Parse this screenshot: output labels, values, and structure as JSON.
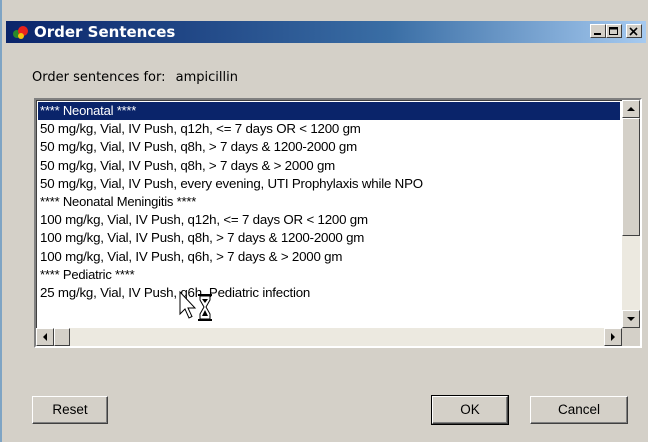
{
  "window": {
    "title": "Order Sentences",
    "icon": "cerner-app-icon",
    "controls": [
      "minimize-icon",
      "maximize-icon",
      "close-icon"
    ]
  },
  "prompt": {
    "label": "Order sentences for:",
    "drug": "ampicillin"
  },
  "list": {
    "selected_index": 0,
    "items": [
      {
        "text": "**** Neonatal ****",
        "kind": "header"
      },
      {
        "text": "50 mg/kg, Vial, IV Push, q12h, <= 7 days OR < 1200 gm",
        "kind": "sentence"
      },
      {
        "text": "50 mg/kg, Vial, IV Push, q8h, > 7 days & 1200-2000 gm",
        "kind": "sentence"
      },
      {
        "text": "50 mg/kg, Vial, IV Push, q8h, > 7 days & > 2000 gm",
        "kind": "sentence"
      },
      {
        "text": "50 mg/kg, Vial, IV Push, every evening, UTI Prophylaxis while NPO",
        "kind": "sentence"
      },
      {
        "text": "**** Neonatal Meningitis ****",
        "kind": "header"
      },
      {
        "text": "100 mg/kg, Vial, IV Push, q12h, <= 7 days OR < 1200 gm",
        "kind": "sentence"
      },
      {
        "text": "100 mg/kg, Vial, IV Push, q8h, > 7 days & 1200-2000 gm",
        "kind": "sentence"
      },
      {
        "text": "100 mg/kg, Vial, IV Push, q6h, > 7 days & > 2000 gm",
        "kind": "sentence"
      },
      {
        "text": "**** Pediatric ****",
        "kind": "header"
      },
      {
        "text": "25 mg/kg, Vial, IV Push, q6h, Pediatric infection",
        "kind": "sentence"
      },
      {
        "text": "",
        "kind": "sentence"
      }
    ]
  },
  "cursor": "arrow-hourglass-busy-icon",
  "buttons": {
    "reset": "Reset",
    "ok": "OK",
    "cancel": "Cancel"
  },
  "colors": {
    "selection": "#0a246a",
    "titlebar_start": "#0a246a",
    "titlebar_end": "#a6caf0",
    "face": "#d4d0c8"
  }
}
